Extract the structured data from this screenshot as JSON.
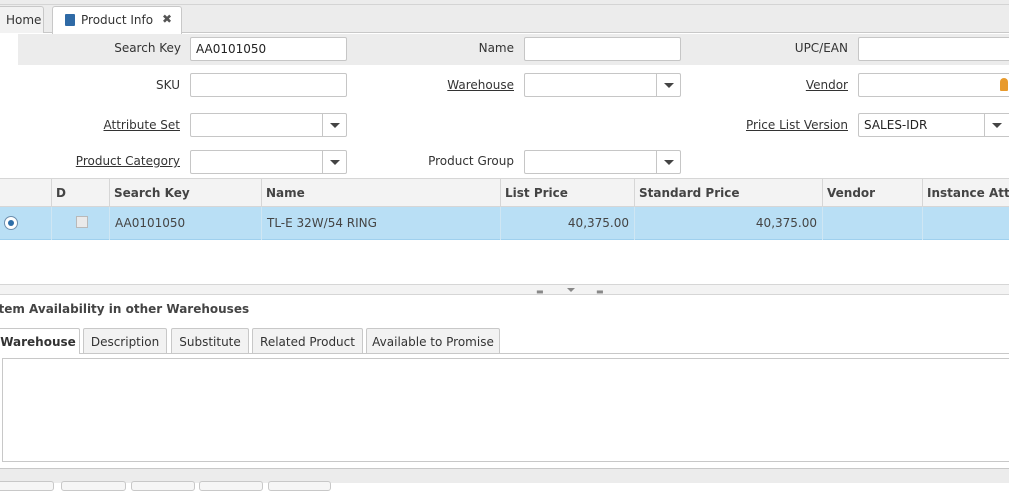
{
  "tabs": {
    "home_label": "Home",
    "active_label": "Product Info"
  },
  "params": {
    "search_key": {
      "label": "Search Key",
      "value": "AA0101050"
    },
    "name": {
      "label": "Name",
      "value": ""
    },
    "upc": {
      "label": "UPC/EAN",
      "value": ""
    },
    "sku": {
      "label": "SKU",
      "value": ""
    },
    "warehouse": {
      "label": "Warehouse",
      "value": ""
    },
    "vendor": {
      "label": "Vendor",
      "value": ""
    },
    "attribute_set": {
      "label": "Attribute Set",
      "value": ""
    },
    "price_list_version": {
      "label": "Price List Version",
      "value": "SALES-IDR"
    },
    "product_category": {
      "label": "Product Category",
      "value": ""
    },
    "product_group": {
      "label": "Product Group",
      "value": ""
    }
  },
  "grid": {
    "columns": [
      "",
      "D",
      "Search Key",
      "Name",
      "List Price",
      "Standard Price",
      "Vendor",
      "Instance Attribute"
    ],
    "rows": [
      {
        "search_key": "AA0101050",
        "name": "TL-E 32W/54 RING",
        "list_price": "40,375.00",
        "standard_price": "40,375.00",
        "vendor": "",
        "instance": ""
      }
    ]
  },
  "section": {
    "title": "Item Availability in other Warehouses"
  },
  "subtabs": [
    "Warehouse",
    "Description",
    "Substitute",
    "Related Product",
    "Available to Promise"
  ],
  "colors": {
    "selected_row": "#b9dff5",
    "panel_bg": "#ececec"
  }
}
